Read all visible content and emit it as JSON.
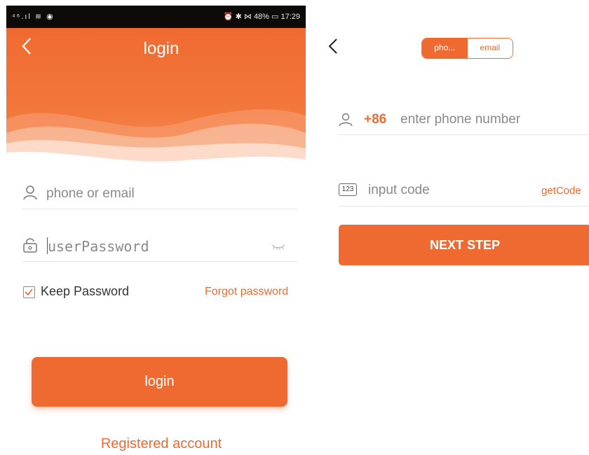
{
  "status_bar": {
    "left_icons": "⁴⁶.ıl ≋ ◉",
    "right_text": "⏰ ✱ ⋈ 48% ▭ 17:29"
  },
  "login_screen": {
    "title": "login",
    "account_placeholder": "phone or email",
    "password_placeholder": "userPassword",
    "keep_password_label": "Keep Password",
    "keep_password_checked": true,
    "forgot_password_label": "Forgot password",
    "login_button_label": "login",
    "register_link": "Registered account"
  },
  "verify_screen": {
    "tabs": [
      {
        "label": "pho...",
        "active": true
      },
      {
        "label": "email",
        "active": false
      }
    ],
    "country_code": "+86",
    "phone_placeholder": "enter phone number",
    "code_icon_text": "123",
    "code_placeholder": "input code",
    "get_code_label": "getCode",
    "next_button_label": "NEXT STEP"
  },
  "colors": {
    "accent": "#ef6a31",
    "status_bar_bg": "#0d0a08"
  }
}
